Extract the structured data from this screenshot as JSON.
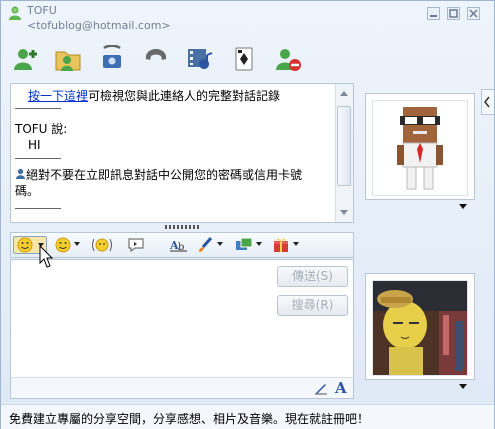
{
  "window": {
    "contact_name": "TOFU",
    "contact_email": "<tofublog@hotmail.com>"
  },
  "toolbar": {
    "icons": [
      "invite-contact-icon",
      "send-files-icon",
      "video-call-icon",
      "voice-call-icon",
      "activities-icon",
      "games-icon",
      "block-contact-icon"
    ]
  },
  "conversation": {
    "history_link": "按一下這裡",
    "history_text": "可檢視您與此連絡人的完整對話記錄",
    "sender_says": "TOFU 說:",
    "message": "HI",
    "warning_line1": "絕對不要在立即訊息對話中公開您的密碼或信用卡號",
    "warning_line2": "碼。"
  },
  "compose": {
    "send_label": "傳送(S)",
    "search_label": "搜尋(R)",
    "value": ""
  },
  "format_toolbar": {
    "items": [
      "emoticon-icon",
      "wink-icon",
      "nudge-icon",
      "voice-clip-icon",
      "font-icon",
      "ink-icon",
      "background-icon",
      "gift-icon"
    ]
  },
  "status": {
    "text": "免費建立專屬的分享空間，分享感想、相片及音樂。現在就註冊吧！"
  },
  "colors": {
    "link": "#0033cc",
    "frame_border": "#b8c7d8",
    "window_bg": "#dfe9f5"
  }
}
